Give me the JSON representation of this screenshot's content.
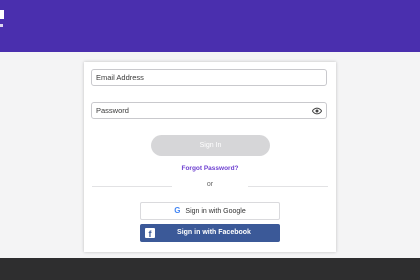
{
  "form": {
    "email_placeholder": "Email Address",
    "password_placeholder": "Password",
    "signin_label": "Sign In",
    "forgot_label": "Forgot Password?",
    "or_label": "or",
    "google_label": "Sign in with Google",
    "facebook_label": "Sign in with Facebook"
  },
  "icons": {
    "eye": "eye-icon",
    "google": "google-icon",
    "facebook": "facebook-icon"
  },
  "colors": {
    "header": "#4a2fae",
    "footer": "#2e2e2f",
    "accent": "#6d3fd0",
    "facebook": "#3b5998",
    "signin_disabled": "#d6d6d8"
  }
}
